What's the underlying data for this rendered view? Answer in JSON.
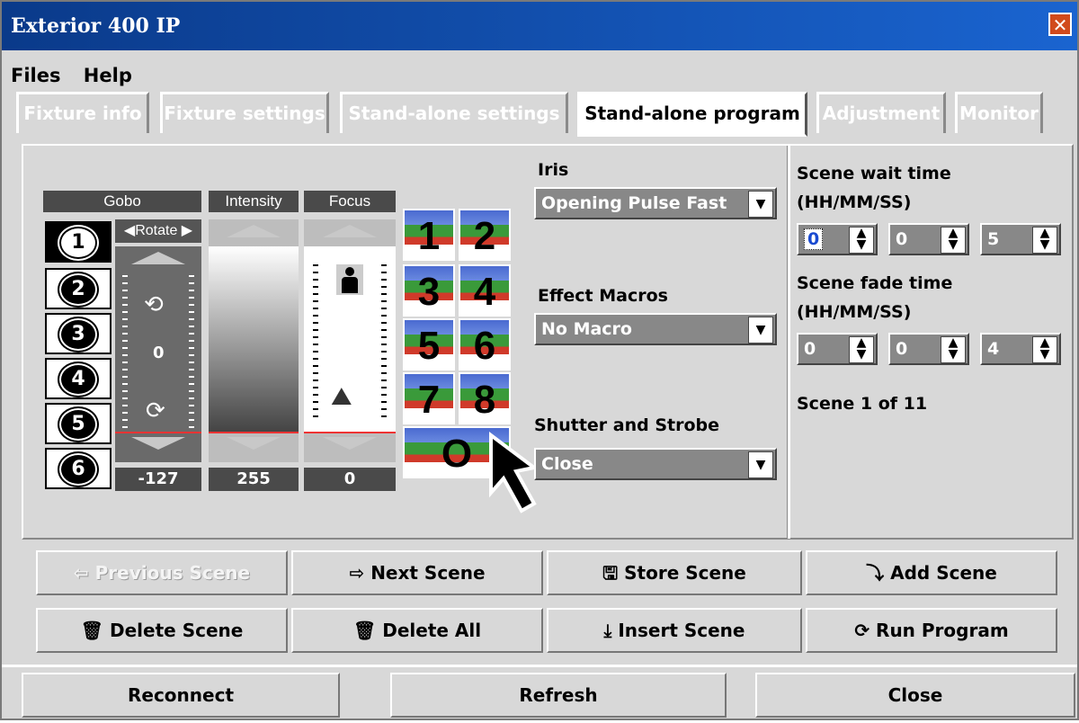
{
  "window": {
    "title": "Exterior 400 IP",
    "close_glyph": "✕"
  },
  "menu": [
    "Files",
    "Help"
  ],
  "tabs": [
    "Fixture info",
    "Fixture settings",
    "Stand-alone settings",
    "Stand-alone program",
    "Adjustment",
    "Monitor"
  ],
  "active_tab": "Stand-alone program",
  "gobo": {
    "headers": [
      "Gobo",
      "Intensity",
      "Focus"
    ],
    "rotate_label": "◀Rotate ▶",
    "buttons": [
      "1",
      "2",
      "3",
      "4",
      "5",
      "6"
    ],
    "selected_button": "1",
    "rotate_value": "0",
    "values": {
      "gobo": "-127",
      "intensity": "255",
      "focus": "0"
    },
    "intensity_level": 1.0
  },
  "scene_tiles": [
    "1",
    "2",
    "3",
    "4",
    "5",
    "6",
    "7",
    "8",
    "O"
  ],
  "iris": {
    "label": "Iris",
    "value": "Opening Pulse Fast"
  },
  "effect_macros": {
    "label": "Effect Macros",
    "value": "No Macro"
  },
  "shutter": {
    "label": "Shutter and Strobe",
    "value": "Close"
  },
  "scene_wait": {
    "label1": "Scene wait time",
    "label2": "(HH/MM/SS)",
    "hh": "0",
    "mm": "0",
    "ss": "5"
  },
  "scene_fade": {
    "label1": "Scene fade time",
    "label2": "(HH/MM/SS)",
    "hh": "0",
    "mm": "0",
    "ss": "4"
  },
  "scene_status": "Scene 1 of 11",
  "actions": {
    "previous": "Previous Scene",
    "next": "Next Scene",
    "store": "Store Scene",
    "add": "Add Scene",
    "delete": "Delete Scene",
    "delete_all": "Delete All",
    "insert": "Insert Scene",
    "run": "Run Program"
  },
  "footer": {
    "reconnect": "Reconnect",
    "refresh": "Refresh",
    "close": "Close"
  }
}
